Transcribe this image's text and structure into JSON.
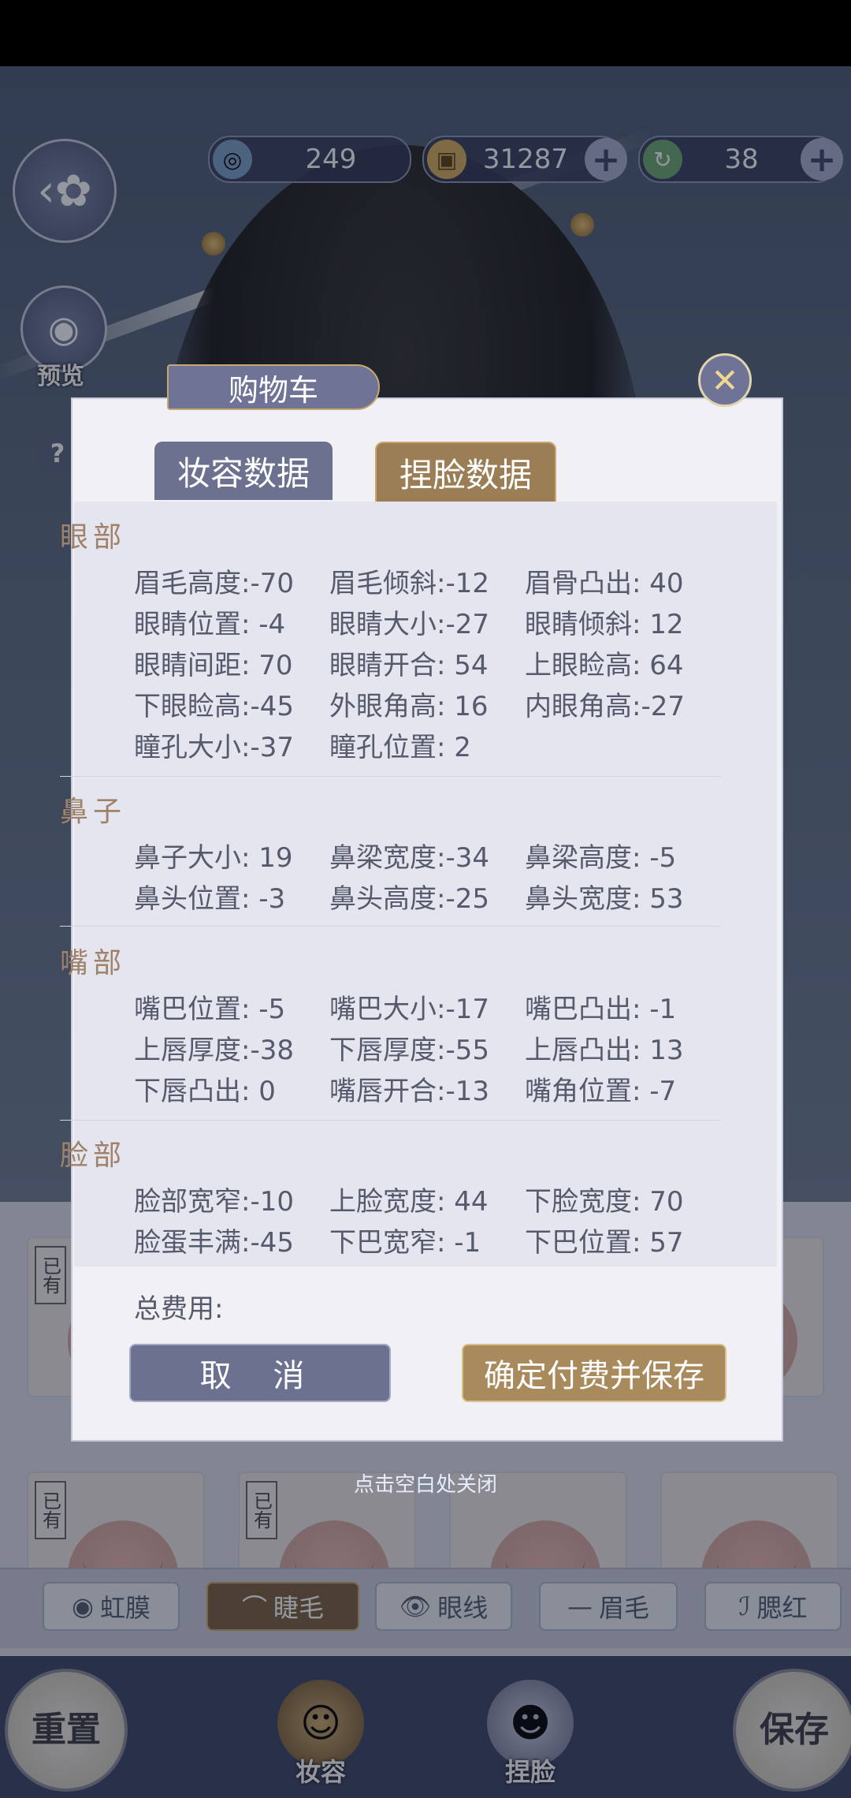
{
  "currencies": [
    {
      "icon": "jade-coin-icon",
      "value": "249"
    },
    {
      "icon": "copper-coin-icon",
      "value": "31287"
    },
    {
      "icon": "green-token-icon",
      "value": "38"
    }
  ],
  "sidebar": {
    "preview_label": "预览",
    "help_label": "?"
  },
  "modal": {
    "title": "购物车",
    "tabs": [
      "妆容数据",
      "捏脸数据"
    ],
    "sections": [
      {
        "title": "眼部",
        "rows": [
          [
            "眉毛高度:-70",
            "眉毛倾斜:-12",
            "眉骨凸出: 40"
          ],
          [
            "眼睛位置: -4",
            "眼睛大小:-27",
            "眼睛倾斜: 12"
          ],
          [
            "眼睛间距: 70",
            "眼睛开合: 54",
            "上眼睑高: 64"
          ],
          [
            "下眼睑高:-45",
            "外眼角高: 16",
            "内眼角高:-27"
          ],
          [
            "瞳孔大小:-37",
            "瞳孔位置:  2",
            ""
          ]
        ]
      },
      {
        "title": "鼻子",
        "rows": [
          [
            "鼻子大小: 19",
            "鼻梁宽度:-34",
            "鼻梁高度: -5"
          ],
          [
            "鼻头位置: -3",
            "鼻头高度:-25",
            "鼻头宽度: 53"
          ]
        ]
      },
      {
        "title": "嘴部",
        "rows": [
          [
            "嘴巴位置: -5",
            "嘴巴大小:-17",
            "嘴巴凸出: -1"
          ],
          [
            "上唇厚度:-38",
            "下唇厚度:-55",
            "上唇凸出: 13"
          ],
          [
            "下唇凸出:  0",
            "嘴唇开合:-13",
            "嘴角位置: -7"
          ]
        ]
      },
      {
        "title": "脸部",
        "rows": [
          [
            "脸部宽窄:-10",
            "上脸宽度: 44",
            "下脸宽度: 70"
          ],
          [
            "脸蛋丰满:-45",
            "下巴宽窄: -1",
            "下巴位置: 57"
          ]
        ]
      }
    ],
    "total_label": "总费用:",
    "cancel_label": "取 消",
    "confirm_label": "确定付费并保存",
    "close_hint": "点击空白处关闭"
  },
  "cards": {
    "owned_label": "已有"
  },
  "sub_tabs": [
    {
      "icon": "iris-icon",
      "label": "虹膜",
      "active": false
    },
    {
      "icon": "eyelash-icon",
      "label": "睫毛",
      "active": true
    },
    {
      "icon": "eyeliner-icon",
      "label": "眼线",
      "active": false
    },
    {
      "icon": "eyebrow-icon",
      "label": "眉毛",
      "active": false
    },
    {
      "icon": "blush-icon",
      "label": "腮红",
      "active": false
    }
  ],
  "nav": {
    "reset_label": "重置",
    "makeup_label": "妆容",
    "face_label": "捏脸",
    "save_label": "保存"
  },
  "colors": {
    "accent_gold": "#a88a5c",
    "accent_purple": "#6d7190",
    "text_brown": "#a0826b"
  }
}
